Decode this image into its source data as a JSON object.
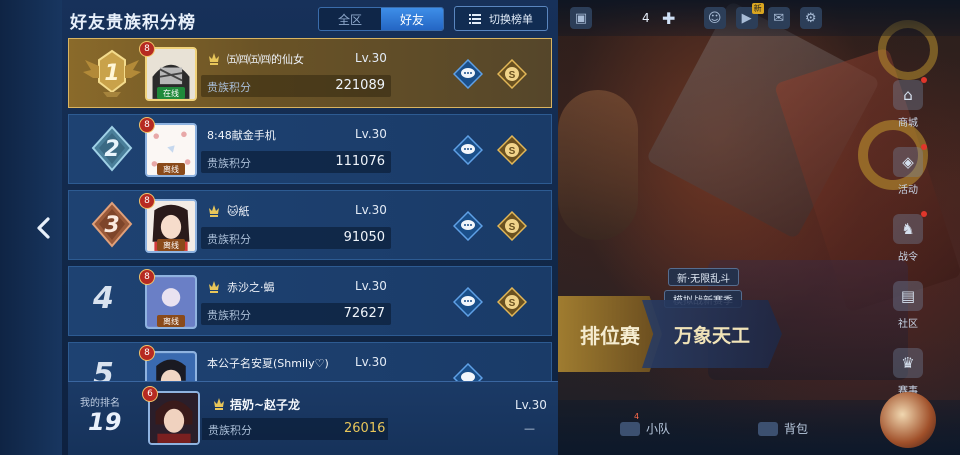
{
  "panel": {
    "title": "好友贵族积分榜",
    "scope_tabs": [
      {
        "label": "全区",
        "active": false
      },
      {
        "label": "好友",
        "active": true
      }
    ],
    "switch_board_label": "切换榜单"
  },
  "rows": [
    {
      "rank": "1",
      "name": "㈤㈣㈤㈣的仙女",
      "level": "Lv.30",
      "score_label": "贵族积分",
      "score": "221089",
      "badge_level": "8",
      "status": "在线",
      "noble": true
    },
    {
      "rank": "2",
      "name": "8:48献金手机",
      "level": "Lv.30",
      "score_label": "贵族积分",
      "score": "111076",
      "badge_level": "8",
      "status": "离线",
      "noble": false
    },
    {
      "rank": "3",
      "name": "🐱紙",
      "level": "Lv.30",
      "score_label": "贵族积分",
      "score": "91050",
      "badge_level": "8",
      "status": "离线",
      "noble": true
    },
    {
      "rank": "4",
      "name": "赤沙之·蝎",
      "level": "Lv.30",
      "score_label": "贵族积分",
      "score": "72627",
      "badge_level": "8",
      "status": "离线",
      "noble": true
    },
    {
      "rank": "5",
      "name": "本公子名安夏(Shmily♡)",
      "level": "Lv.30",
      "score_label": "",
      "score": "",
      "badge_level": "8",
      "status": "",
      "noble": false
    }
  ],
  "my_rank": {
    "label": "我的排名",
    "rank": "19",
    "name": "捂奶~赵子龙",
    "level": "Lv.30",
    "score_label": "贵族积分",
    "score": "26016",
    "extra": "—",
    "badge_level": "6"
  },
  "top_bar": {
    "resource_count": "4",
    "badge": "新"
  },
  "right_nav": [
    {
      "label": "商城",
      "icon": "shop-icon"
    },
    {
      "label": "活动",
      "icon": "event-icon"
    },
    {
      "label": "战令",
      "icon": "pass-icon"
    },
    {
      "label": "社区",
      "icon": "community-icon"
    },
    {
      "label": "赛事",
      "icon": "trophy-icon"
    }
  ],
  "modes": {
    "rank_label": "排位赛",
    "event_label": "万象天工",
    "tag_1": "新·无限乱斗",
    "tag_2": "模拟战新赛季"
  },
  "bottom": {
    "team_label": "小队",
    "bag_label": "背包",
    "team_badge": "4"
  },
  "colors": {
    "panel_bg": "#17315a",
    "active_tab": "#2f7ad6",
    "gold": "#d9b461",
    "my_score": "#e8c65a"
  }
}
